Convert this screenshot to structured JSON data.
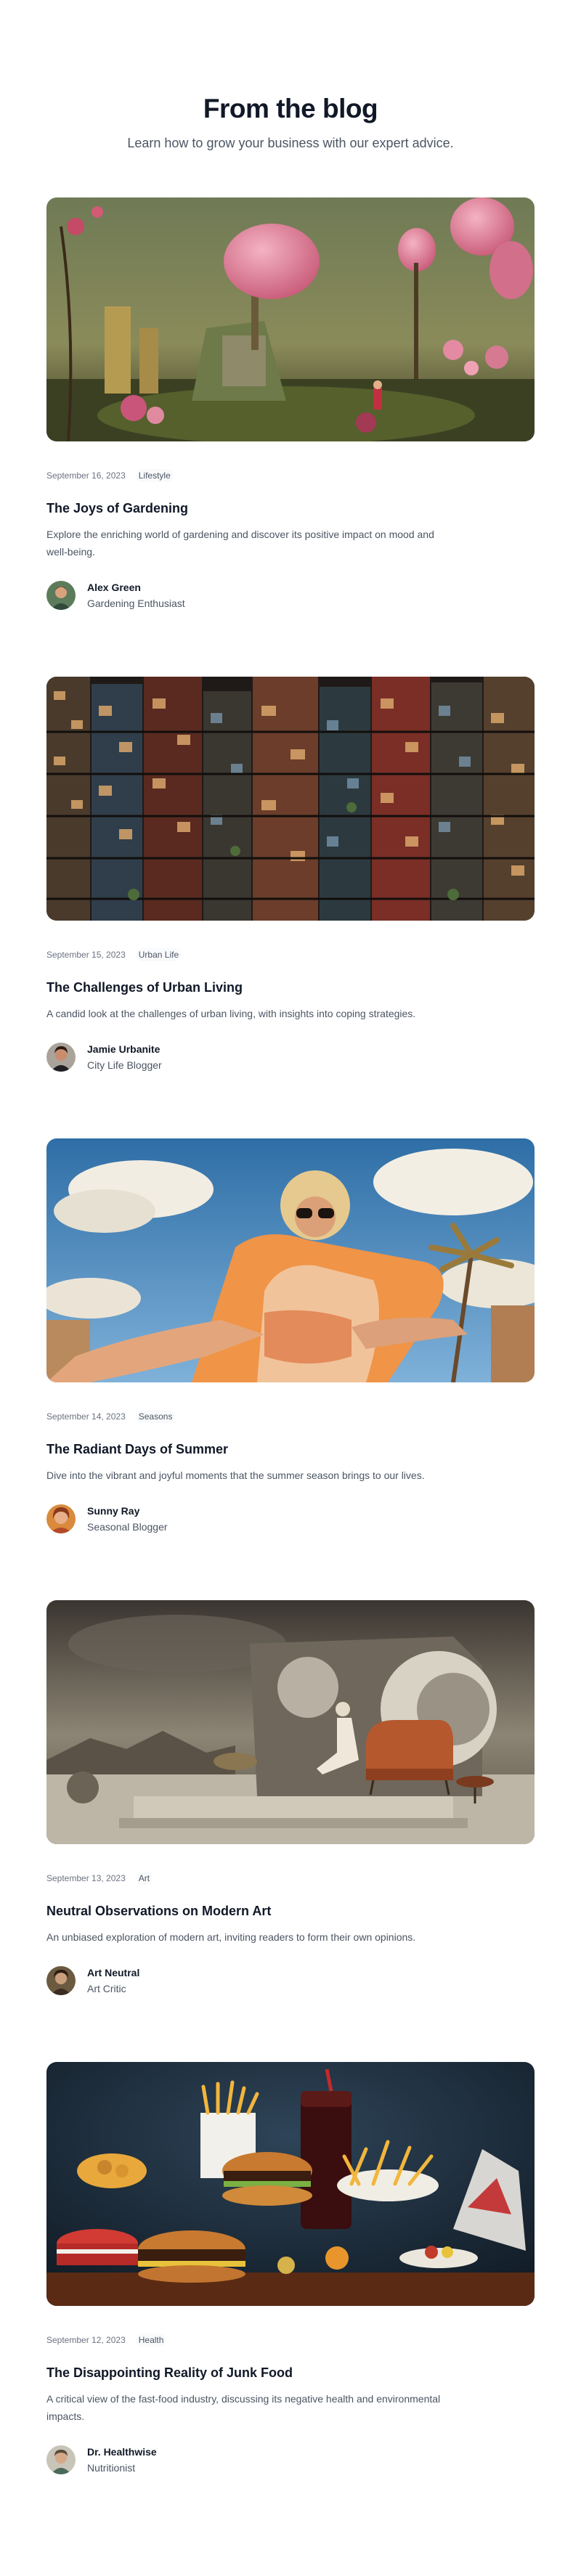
{
  "header": {
    "title": "From the blog",
    "subtitle": "Learn how to grow your business with our expert advice."
  },
  "posts": [
    {
      "date": "September 16, 2023",
      "category": "Lifestyle",
      "title": "The Joys of Gardening",
      "excerpt": "Explore the enriching world of gardening and discover its positive impact on mood and well-being.",
      "author": {
        "name": "Alex Green",
        "role": "Gardening Enthusiast"
      },
      "image_semantic": "fantasy-garden-illustration"
    },
    {
      "date": "September 15, 2023",
      "category": "Urban Life",
      "title": "The Challenges of Urban Living",
      "excerpt": "A candid look at the challenges of urban living, with insights into coping strategies.",
      "author": {
        "name": "Jamie Urbanite",
        "role": "City Life Blogger"
      },
      "image_semantic": "dense-apartment-blocks-illustration"
    },
    {
      "date": "September 14, 2023",
      "category": "Seasons",
      "title": "The Radiant Days of Summer",
      "excerpt": "Dive into the vibrant and joyful moments that the summer season brings to our lives.",
      "author": {
        "name": "Sunny Ray",
        "role": "Seasonal Blogger"
      },
      "image_semantic": "summer-lounger-portrait-illustration"
    },
    {
      "date": "September 13, 2023",
      "category": "Art",
      "title": "Neutral Observations on Modern Art",
      "excerpt": "An unbiased exploration of modern art, inviting readers to form their own opinions.",
      "author": {
        "name": "Art Neutral",
        "role": "Art Critic"
      },
      "image_semantic": "surreal-art-scene-illustration"
    },
    {
      "date": "September 12, 2023",
      "category": "Health",
      "title": "The Disappointing Reality of Junk Food",
      "excerpt": "A critical view of the fast-food industry, discussing its negative health and environmental impacts.",
      "author": {
        "name": "Dr. Healthwise",
        "role": "Nutritionist"
      },
      "image_semantic": "fast-food-spread-illustration"
    }
  ]
}
